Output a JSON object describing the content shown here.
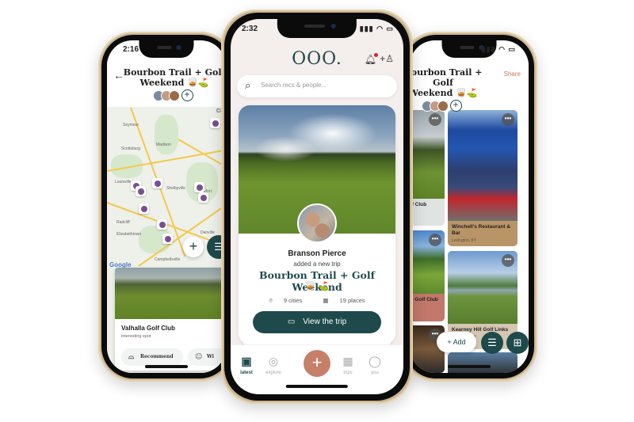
{
  "left_phone": {
    "status_time": "2:16",
    "back_icon": "←",
    "trip_title_line1": "Bourbon Trail + Golf",
    "trip_title_line2": "Weekend 🥃⛳",
    "add_member": "+",
    "map": {
      "labels": [
        "Seymour",
        "Scottsburg",
        "Madison",
        "Louisville",
        "Shelbyville",
        "Frankfort",
        "Radcliff",
        "Elizabethtown",
        "Danville",
        "Campbellsville",
        "Cin"
      ],
      "google_label": "Google",
      "add_icon": "+",
      "list_icon": "☰"
    },
    "place_card": {
      "name": "Valhalla Golf Club",
      "subtitle": "interesting spot",
      "recommend_label": "Recommend",
      "second_action_label": "Wi"
    }
  },
  "center_phone": {
    "status_time": "2:32",
    "logo": "OOO.",
    "search_placeholder": "Search recs & people...",
    "feed": {
      "user_name": "Branson Pierce",
      "action": "added a new trip",
      "trip_title": "Bourbon Trail + Golf Weekend",
      "trip_emoji": "🥃 ⛳",
      "cities": "9 cities",
      "places": "19 places",
      "view_button": "View the trip"
    },
    "tabs": [
      {
        "label": "latest",
        "icon": "▣"
      },
      {
        "label": "explore",
        "icon": "◎"
      },
      {
        "label": "trips",
        "icon": "▦"
      },
      {
        "label": "you",
        "icon": "◯"
      }
    ],
    "fab_icon": "+"
  },
  "right_phone": {
    "trip_title_line1": "Bourbon Trail + Golf",
    "trip_title_line2": "Weekend 🥃⛳",
    "share_label": "Share",
    "add_member": "+",
    "tiles": [
      {
        "title": "lf Club",
        "subtitle": ""
      },
      {
        "title": "Winchell's Restaurant & Bar",
        "subtitle": "Lexington, KY"
      },
      {
        "title": "e Golf Club",
        "subtitle": ""
      },
      {
        "title": "Kearney Hill Golf Links",
        "subtitle": "Lexington, KY"
      }
    ],
    "more_icon": "•••",
    "add_button": "+ Add",
    "list_icon": "☰",
    "map_icon": "⊞"
  }
}
